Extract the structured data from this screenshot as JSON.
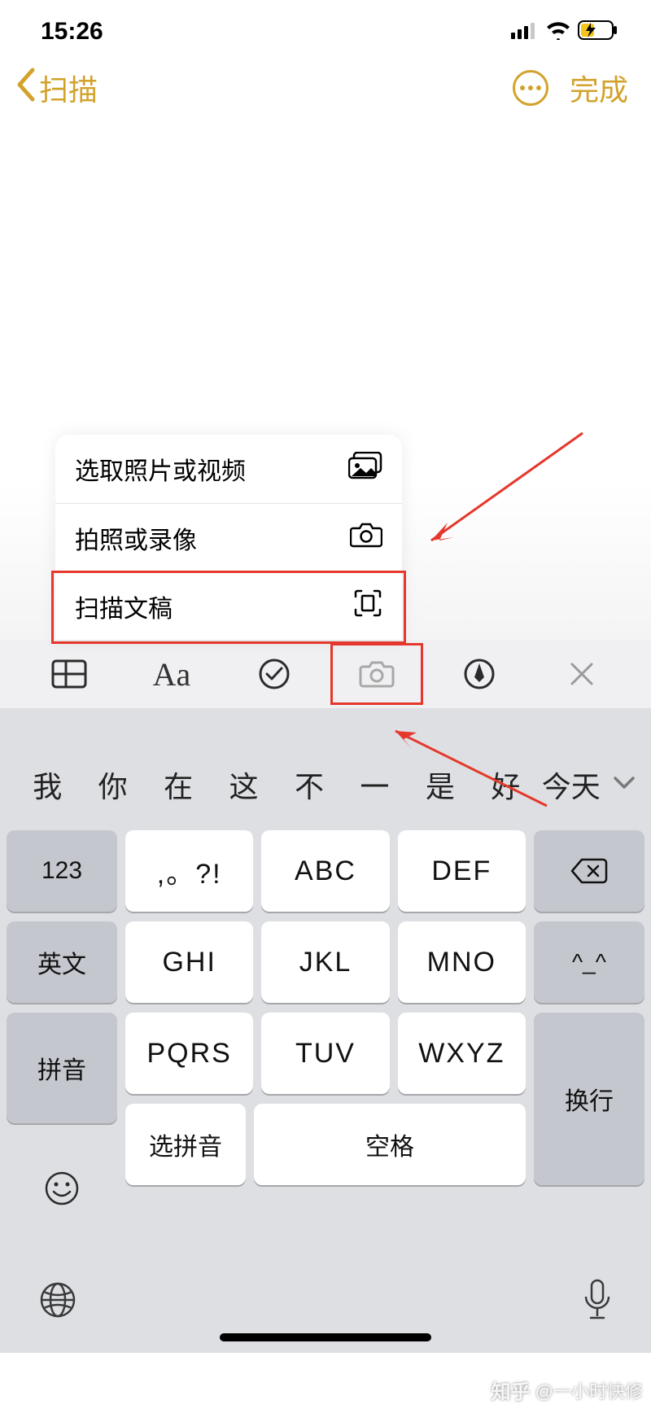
{
  "status": {
    "time": "15:26"
  },
  "nav": {
    "back": "扫描",
    "done": "完成"
  },
  "popup": {
    "items": [
      {
        "label": "选取照片或视频"
      },
      {
        "label": "拍照或录像"
      },
      {
        "label": "扫描文稿"
      }
    ]
  },
  "toolbar": {
    "text_format": "Aa"
  },
  "candidates": [
    "我",
    "你",
    "在",
    "这",
    "不",
    "一",
    "是",
    "好",
    "今天"
  ],
  "keys": {
    "k123": "123",
    "punct": ",。?!",
    "abc": "ABC",
    "def": "DEF",
    "eng": "英文",
    "ghi": "GHI",
    "jkl": "JKL",
    "mno": "MNO",
    "face": "^_^",
    "pinyin": "拼音",
    "pqrs": "PQRS",
    "tuv": "TUV",
    "wxyz": "WXYZ",
    "enter": "换行",
    "select_pinyin": "选拼音",
    "space": "空格"
  },
  "watermark": {
    "site": "知乎",
    "author": "@一小时快修"
  },
  "colors": {
    "accent": "#d2a22b",
    "annotate": "#e5382c"
  }
}
